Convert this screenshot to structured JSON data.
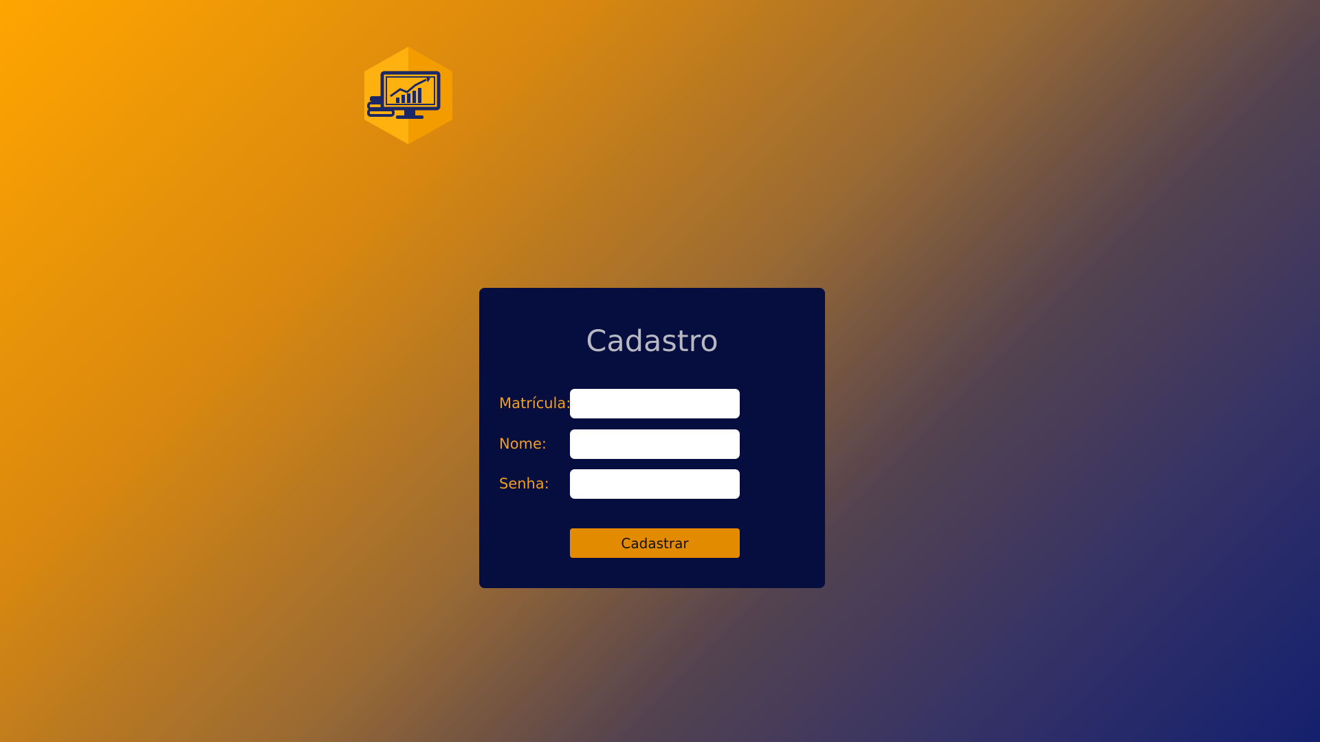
{
  "logo": {
    "icon": "monitor-growth-chart-books-icon",
    "hex_color_light": "#ffb20f",
    "hex_color_dark": "#f39c00",
    "figure_color": "#1c2766"
  },
  "form": {
    "title": "Cadastro",
    "fields": [
      {
        "label": "Matrícula:",
        "value": "",
        "placeholder": ""
      },
      {
        "label": "Nome:",
        "value": "",
        "placeholder": ""
      },
      {
        "label": "Senha:",
        "value": "",
        "placeholder": ""
      }
    ],
    "submit_label": "Cadastrar"
  },
  "colors": {
    "card_background": "#060e3f",
    "label_color": "#f0a020",
    "title_color": "#b8b8c2",
    "button_color": "#e38b00"
  }
}
